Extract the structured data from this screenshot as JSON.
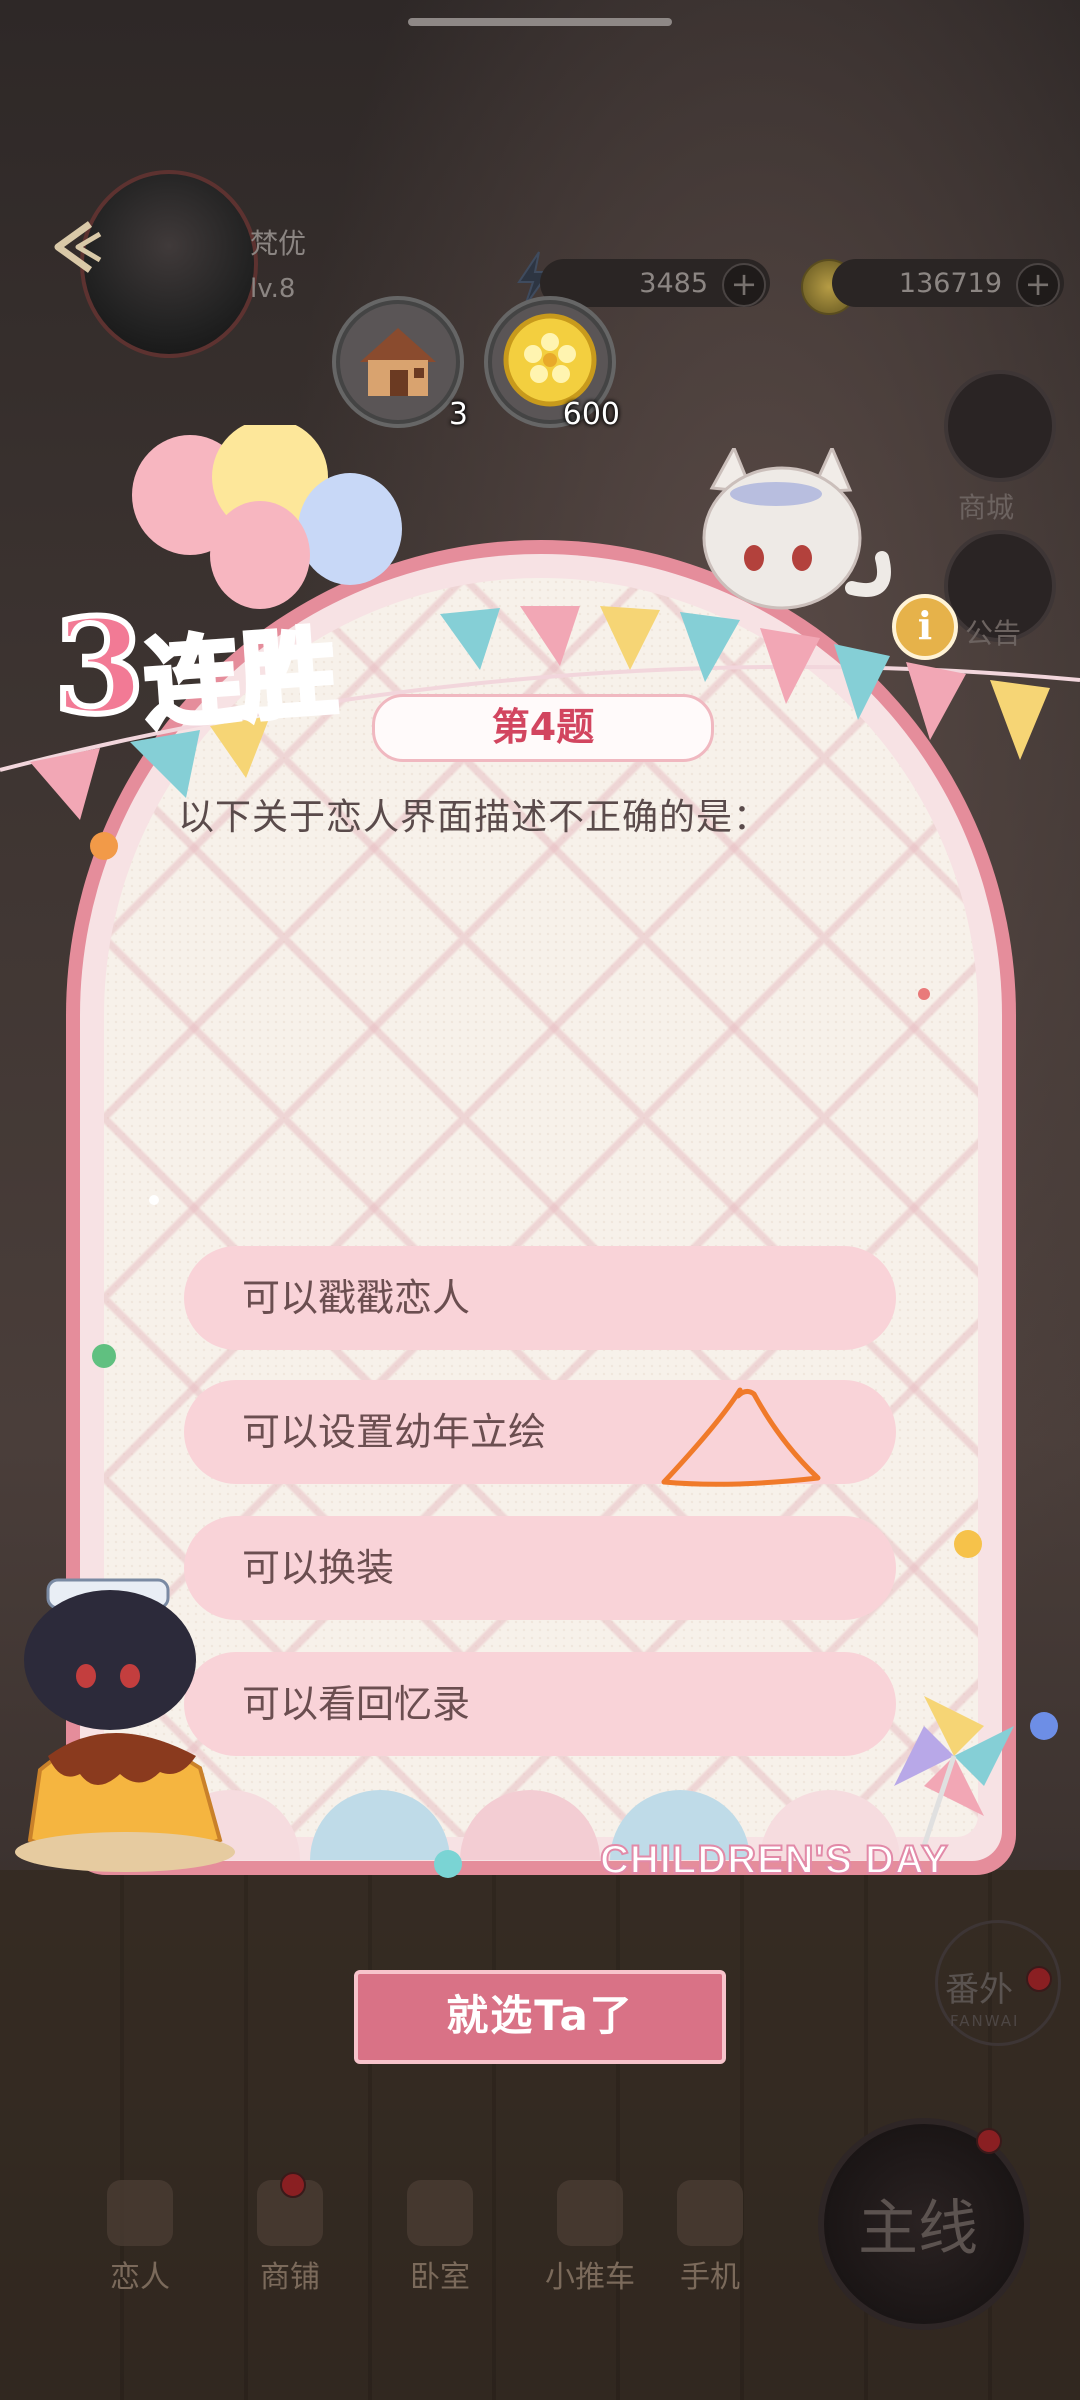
{
  "player": {
    "name": "梵优",
    "level": "lv.8"
  },
  "resources": {
    "energy": "3485",
    "coins": "136719"
  },
  "rewards": [
    {
      "icon": "house-icon",
      "count": "3"
    },
    {
      "icon": "gold-coin-icon",
      "count": "600"
    }
  ],
  "side_menu": {
    "shop": "商城",
    "notice": "公告"
  },
  "streak": {
    "number": "3",
    "text": "连胜"
  },
  "quiz": {
    "title": "第4题",
    "question": "以下关于恋人界面描述不正确的是：",
    "options": [
      "可以戳戳恋人",
      "可以设置幼年立绘",
      "可以换装",
      "可以看回忆录"
    ],
    "confirm_label": "就选Ta了"
  },
  "event_label": "CHILDREN'S DAY",
  "bottom_nav": [
    "恋人",
    "商铺",
    "卧室",
    "小推车",
    "手机"
  ],
  "main_button": "主线",
  "extra_button": {
    "label": "番外",
    "sub": "FANWAI"
  },
  "colors": {
    "panel_border": "#e58d9b",
    "option_bg": "#f9d3d8",
    "title_text": "#d2455f",
    "confirm_bg": "#d97286"
  }
}
